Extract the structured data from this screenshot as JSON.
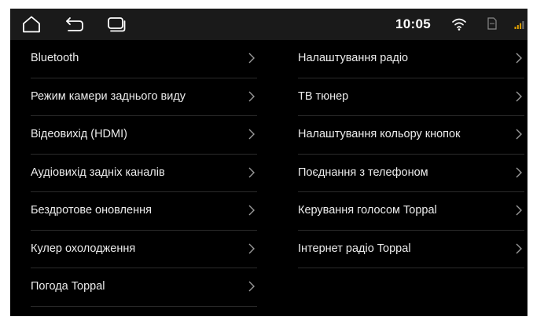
{
  "status_bar": {
    "time": "10:05",
    "icons": [
      "home-icon",
      "back-icon",
      "recent-apps-icon",
      "wifi-icon",
      "sd-card-icon",
      "signal-icon"
    ]
  },
  "settings": {
    "left": [
      {
        "label": "Bluetooth"
      },
      {
        "label": "Режим камери заднього виду"
      },
      {
        "label": "Відеовихід (HDMI)"
      },
      {
        "label": "Аудіовихід задніх каналів"
      },
      {
        "label": "Бездротове оновлення"
      },
      {
        "label": "Кулер охолодження"
      },
      {
        "label": "Погода Toppal"
      }
    ],
    "right": [
      {
        "label": "Налаштування радіо"
      },
      {
        "label": "ТВ тюнер"
      },
      {
        "label": "Налаштування кольору кнопок"
      },
      {
        "label": "Поєднання з телефоном"
      },
      {
        "label": "Керування голосом Toppal"
      },
      {
        "label": "Інтернет радіо Toppal"
      }
    ]
  },
  "colors": {
    "background": "#000000",
    "status_bar": "#1a1a1a",
    "text": "#ececec",
    "divider": "#2b2b2b",
    "chevron": "#9a9a9a"
  }
}
